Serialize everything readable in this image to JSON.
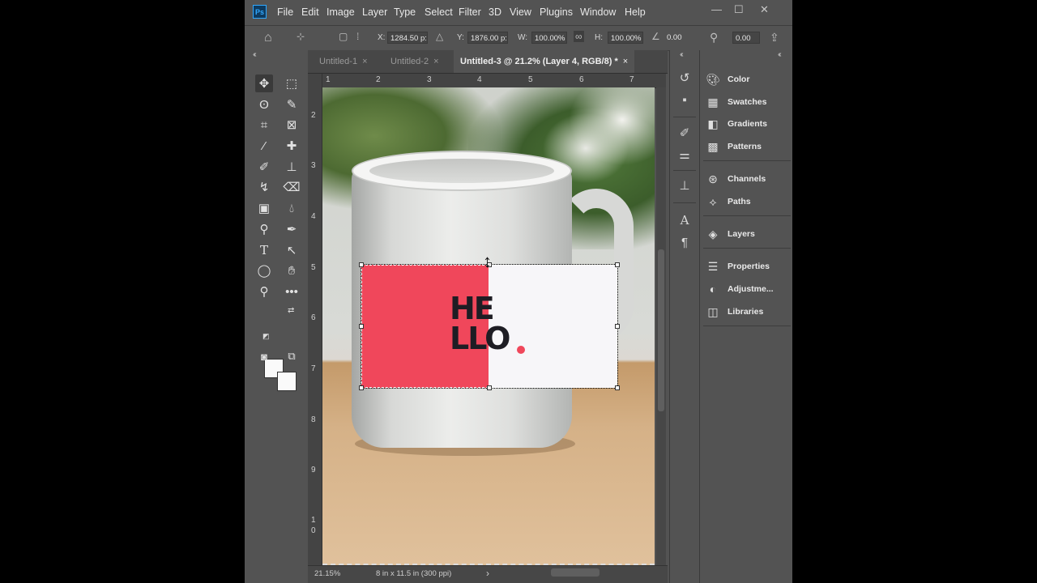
{
  "menubar": {
    "logo": "Ps",
    "items": [
      "File",
      "Edit",
      "Image",
      "Layer",
      "Type",
      "Select",
      "Filter",
      "3D",
      "View",
      "Plugins",
      "Window",
      "Help"
    ],
    "window_controls": [
      "—",
      "☐",
      "✕"
    ]
  },
  "options": {
    "x_label": "X:",
    "x_value": "1284.50 p:",
    "y_label": "Y:",
    "y_value": "1876.00 p:",
    "w_label": "W:",
    "w_value": "100.00%",
    "h_label": "H:",
    "h_value": "100.00%",
    "angle_value": "0.00",
    "interp_value": "0.00"
  },
  "tabs": [
    {
      "label": "Untitled-1",
      "close": "×"
    },
    {
      "label": "Untitled-2",
      "close": "×"
    },
    {
      "label": "Untitled-3 @ 21.2% (Layer 4, RGB/8) *",
      "close": "×"
    }
  ],
  "ruler": {
    "top": [
      "1",
      "2",
      "3",
      "4",
      "5",
      "6",
      "7"
    ],
    "left": [
      "2",
      "3",
      "4",
      "5",
      "6",
      "7",
      "8",
      "9",
      "1",
      "0"
    ]
  },
  "canvas": {
    "text_line1": "HE",
    "text_line2": "LLO",
    "accent_color": "#f0475b"
  },
  "status": {
    "zoom": "21.15%",
    "doc_info": "8 in x 11.5 in (300 ppi)",
    "arrow": "›"
  },
  "panels": {
    "group1": [
      "Color",
      "Swatches",
      "Gradients",
      "Patterns"
    ],
    "group2": [
      "Channels",
      "Paths"
    ],
    "group3": [
      "Layers"
    ],
    "group4": [
      "Properties",
      "Adjustme...",
      "Libraries"
    ]
  },
  "tools": [
    "move-tool",
    "marquee-tool",
    "lasso-tool",
    "quick-select-tool",
    "crop-tool",
    "frame-tool",
    "eyedropper-tool",
    "healing-tool",
    "brush-tool",
    "stamp-tool",
    "history-brush-tool",
    "eraser-tool",
    "gradient-tool",
    "blur-tool",
    "dodge-tool",
    "pen-tool",
    "type-tool",
    "path-select-tool",
    "ellipse-tool",
    "hand-tool",
    "zoom-tool",
    "more-tools"
  ],
  "colors": {
    "foreground": "#fafafa",
    "background": "#fafafa",
    "chrome": "#535353"
  }
}
